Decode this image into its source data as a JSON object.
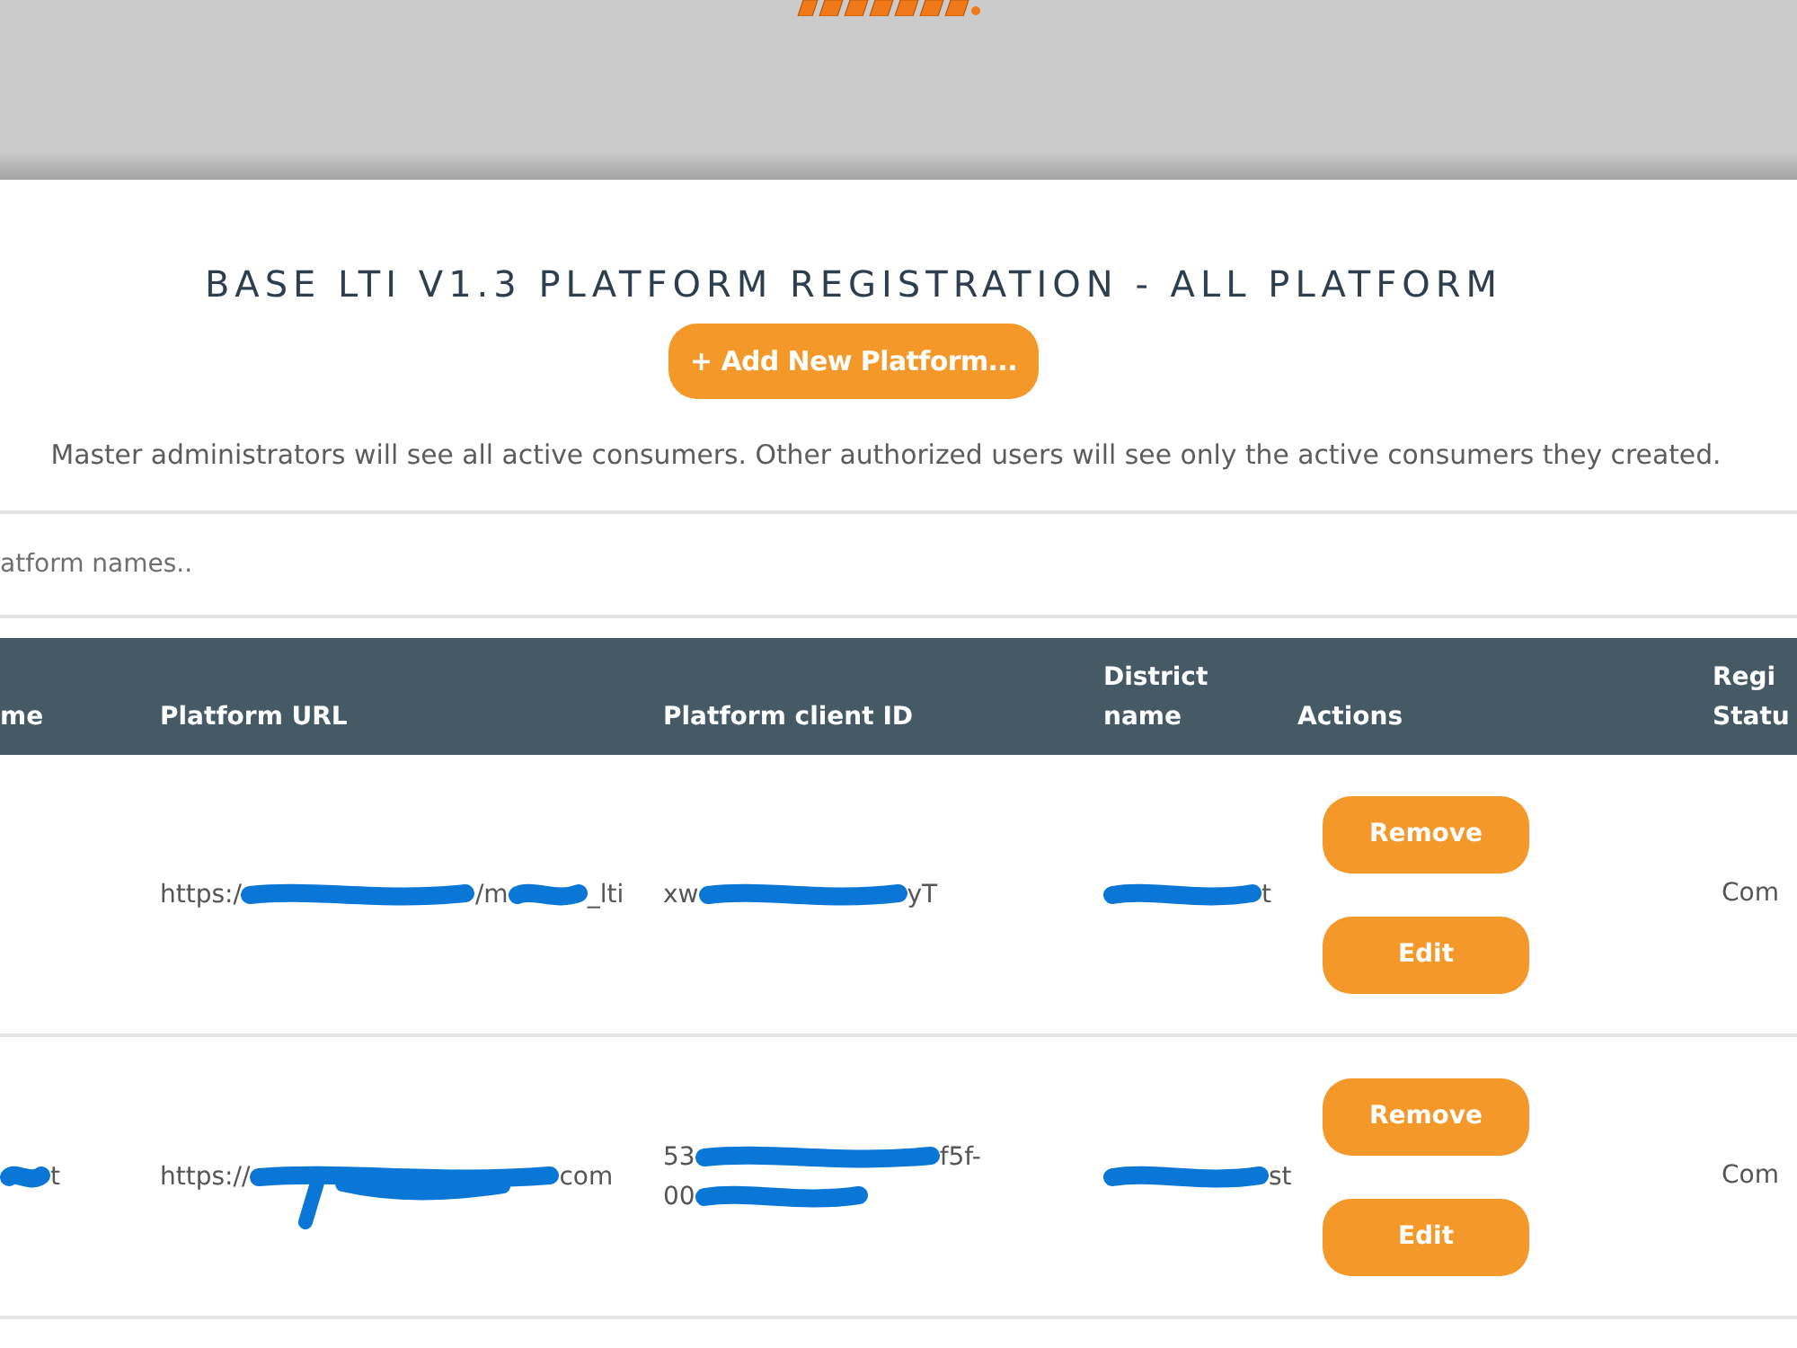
{
  "title": "BASE LTI V1.3 PLATFORM REGISTRATION - ALL PLATFORM",
  "add_button": {
    "label": "+ Add New Platform..."
  },
  "note": "Master administrators will see all active consumers. Other authorized users will see only the active consumers they created.",
  "search": {
    "placeholder": "atform names.."
  },
  "table": {
    "columns": [
      "me",
      "Platform URL",
      "Platform client ID",
      "District name",
      "Actions",
      "Regi Statu"
    ],
    "rows": [
      {
        "url": [
          [
            {
              "kind": "text",
              "text": "https:/"
            },
            {
              "kind": "redacted"
            },
            {
              "kind": "text",
              "text": "/m"
            },
            {
              "kind": "redacted"
            },
            {
              "kind": "text",
              "text": "_lti"
            }
          ]
        ],
        "client_id": [
          [
            {
              "kind": "text",
              "text": "xw"
            },
            {
              "kind": "redacted"
            },
            {
              "kind": "text",
              "text": "yT"
            }
          ]
        ],
        "district": [
          [
            {
              "kind": "redacted"
            },
            {
              "kind": "text",
              "text": "t"
            }
          ]
        ],
        "actions": [
          "Remove",
          "Edit"
        ],
        "status": "Com"
      },
      {
        "name": [
          [
            {
              "kind": "redacted"
            },
            {
              "kind": "text",
              "text": "t"
            }
          ]
        ],
        "url": [
          [
            {
              "kind": "text",
              "text": "https://"
            },
            {
              "kind": "redacted"
            },
            {
              "kind": "text",
              "text": "com"
            }
          ]
        ],
        "client_id": [
          [
            {
              "kind": "text",
              "text": "53"
            },
            {
              "kind": "redacted"
            },
            {
              "kind": "text",
              "text": "f5f-"
            }
          ],
          [
            {
              "kind": "text",
              "text": "00"
            },
            {
              "kind": "redacted"
            }
          ]
        ],
        "district": [
          [
            {
              "kind": "redacted"
            },
            {
              "kind": "text",
              "text": "st"
            }
          ]
        ],
        "actions": [
          "Remove",
          "Edit"
        ],
        "status": "Com"
      }
    ]
  }
}
